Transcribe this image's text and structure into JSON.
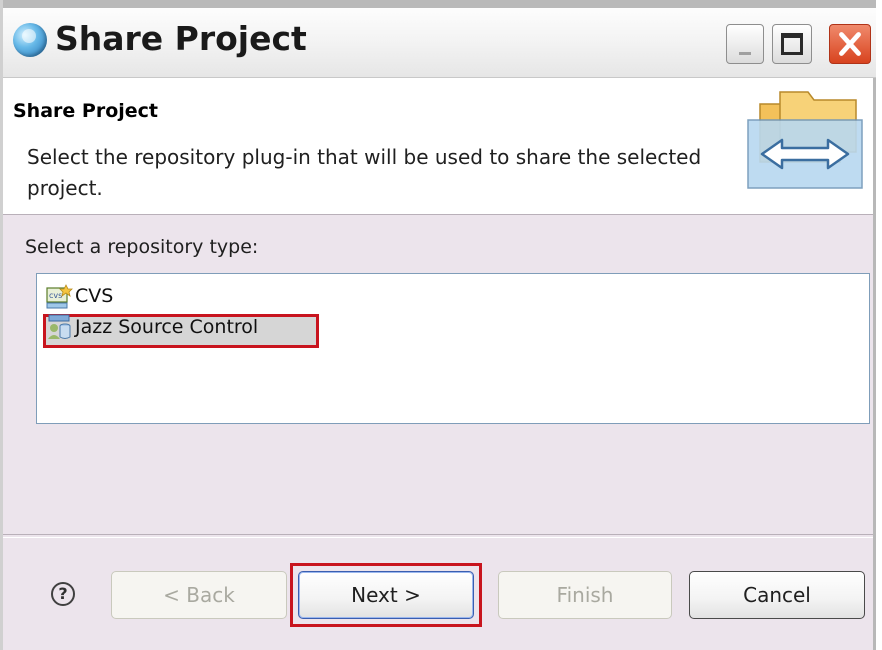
{
  "window": {
    "title": "Share Project"
  },
  "banner": {
    "title": "Share Project",
    "description": "Select the repository plug-in that will be used to share the selected project."
  },
  "body": {
    "label": "Select a repository type:",
    "repository_types": [
      {
        "label": "CVS",
        "icon": "cvs-icon"
      },
      {
        "label": "Jazz Source Control",
        "icon": "jazz-source-control-icon",
        "selected": true
      }
    ]
  },
  "buttons": {
    "help": "?",
    "back": "< Back",
    "next": "Next >",
    "finish": "Finish",
    "cancel": "Cancel"
  },
  "colors": {
    "dialog_background": "#ece4ec",
    "highlight_annotation": "#c8141e",
    "close_button": "#d8431f"
  }
}
